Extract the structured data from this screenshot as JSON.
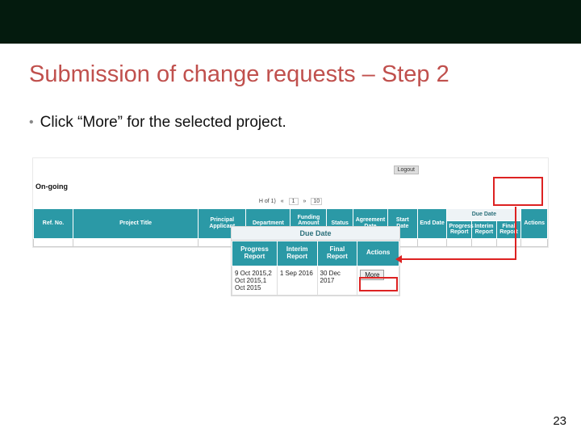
{
  "title": "Submission of change requests – Step 2",
  "bullet": "Click “More” for the selected project.",
  "page_number": "23",
  "shot1": {
    "logout": "Logout",
    "ongoing": "On-going",
    "pager_prefix": "H of 1)",
    "pager_page": "1",
    "pager_size": "10",
    "due_date": "Due Date",
    "headers": {
      "ref": "Ref. No.",
      "title": "Project Title",
      "pi": "Principal Applicant",
      "dept": "Department",
      "fund": "Funding Amount (HK$)",
      "status": "Status",
      "agr": "Agreement Date",
      "start": "Start Date",
      "end": "End Date",
      "prog": "Progress Report",
      "interim": "Interim Report",
      "final": "Final Report",
      "actions": "Actions"
    }
  },
  "shot2": {
    "due_date": "Due Date",
    "headers": {
      "prog": "Progress Report",
      "interim": "Interim Report",
      "final": "Final Report",
      "actions": "Actions"
    },
    "row": {
      "prog": "9 Oct 2015,2 Oct 2015,1 Oct 2015",
      "interim": "1 Sep 2016",
      "final": "30 Dec 2017",
      "more": "More"
    }
  }
}
